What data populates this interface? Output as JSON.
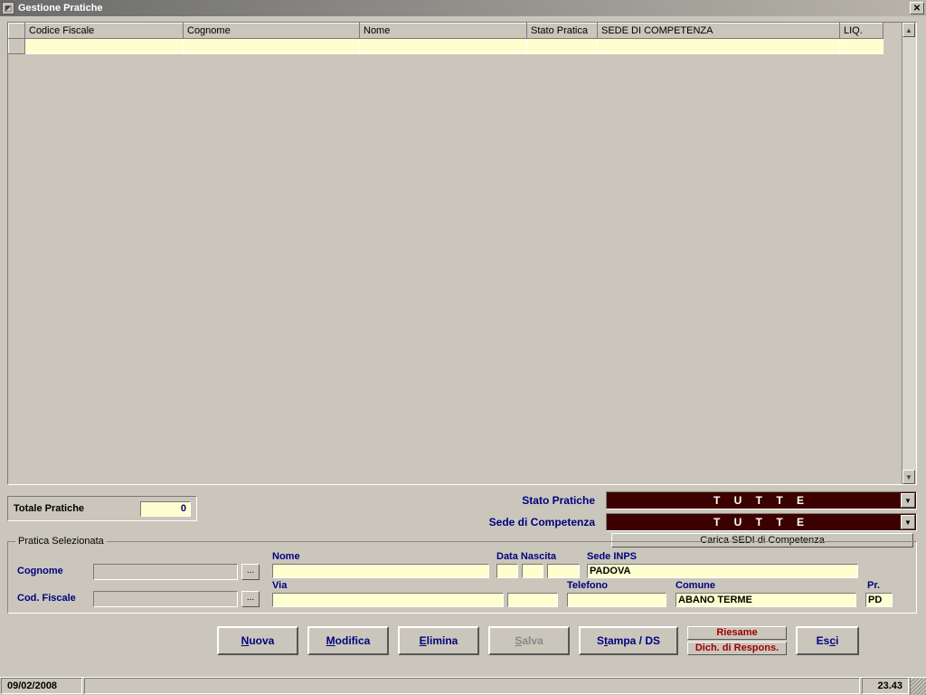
{
  "window": {
    "title": "Gestione Pratiche"
  },
  "grid": {
    "columns": {
      "codfisc": "Codice Fiscale",
      "cognome": "Cognome",
      "nome": "Nome",
      "stato": "Stato Pratica",
      "sede": "SEDE DI COMPETENZA",
      "liq": "LIQ."
    },
    "rows": [
      {
        "codfisc": "",
        "cognome": "",
        "nome": "",
        "stato": "",
        "sede": "",
        "liq": ""
      }
    ]
  },
  "totals": {
    "label": "Totale Pratiche",
    "value": "0"
  },
  "filters": {
    "stato_label": "Stato Pratiche",
    "stato_value": "T U T T E",
    "sede_label": "Sede di Competenza",
    "sede_value": "T U T T E",
    "carica_sedi_label": "Carica SEDI di Competenza"
  },
  "selected": {
    "legend": "Pratica Selezionata",
    "cognome_label": "Cognome",
    "cognome_value": "",
    "codfisc_label": "Cod. Fiscale",
    "codfisc_value": "",
    "nome_label": "Nome",
    "nome_value": "",
    "datanascita_label": "Data Nascita",
    "dn_d": "",
    "dn_m": "",
    "dn_y": "",
    "sedeinps_label": "Sede INPS",
    "sedeinps_value": "PADOVA",
    "via_label": "Via",
    "via_value": "",
    "civ_value": "",
    "telefono_label": "Telefono",
    "telefono_value": "",
    "comune_label": "Comune",
    "comune_value": "ABANO TERME",
    "pr_label": "Pr.",
    "pr_value": "PD"
  },
  "buttons": {
    "nuova": "Nuova",
    "modifica": "Modifica",
    "elimina": "Elimina",
    "salva": "Salva",
    "stampa": "Stampa / DS",
    "riesame": "Riesame",
    "dich": "Dich. di Respons.",
    "esci": "Esci"
  },
  "status": {
    "date": "09/02/2008",
    "time": "23.43"
  }
}
